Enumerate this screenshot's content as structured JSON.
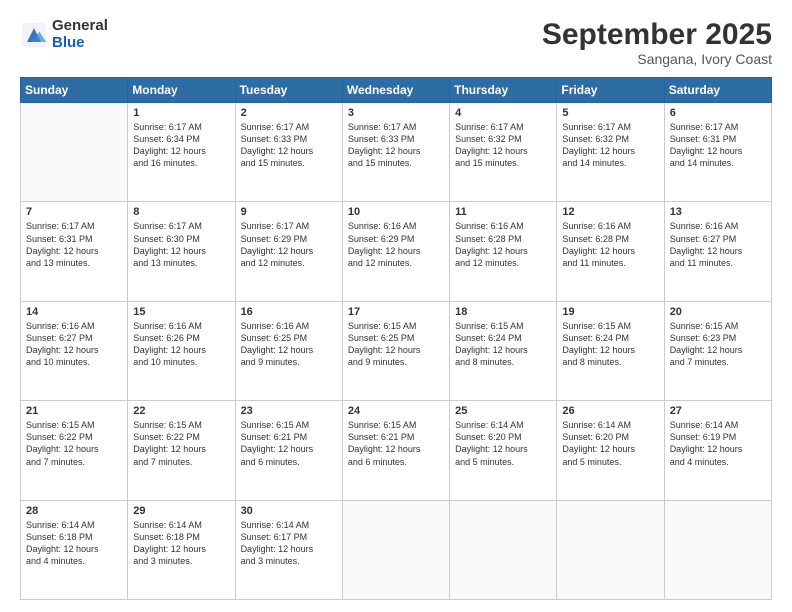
{
  "logo": {
    "general": "General",
    "blue": "Blue"
  },
  "title": {
    "month": "September 2025",
    "location": "Sangana, Ivory Coast"
  },
  "days_header": [
    "Sunday",
    "Monday",
    "Tuesday",
    "Wednesday",
    "Thursday",
    "Friday",
    "Saturday"
  ],
  "weeks": [
    [
      {
        "day": "",
        "info": ""
      },
      {
        "day": "1",
        "info": "Sunrise: 6:17 AM\nSunset: 6:34 PM\nDaylight: 12 hours\nand 16 minutes."
      },
      {
        "day": "2",
        "info": "Sunrise: 6:17 AM\nSunset: 6:33 PM\nDaylight: 12 hours\nand 15 minutes."
      },
      {
        "day": "3",
        "info": "Sunrise: 6:17 AM\nSunset: 6:33 PM\nDaylight: 12 hours\nand 15 minutes."
      },
      {
        "day": "4",
        "info": "Sunrise: 6:17 AM\nSunset: 6:32 PM\nDaylight: 12 hours\nand 15 minutes."
      },
      {
        "day": "5",
        "info": "Sunrise: 6:17 AM\nSunset: 6:32 PM\nDaylight: 12 hours\nand 14 minutes."
      },
      {
        "day": "6",
        "info": "Sunrise: 6:17 AM\nSunset: 6:31 PM\nDaylight: 12 hours\nand 14 minutes."
      }
    ],
    [
      {
        "day": "7",
        "info": "Sunrise: 6:17 AM\nSunset: 6:31 PM\nDaylight: 12 hours\nand 13 minutes."
      },
      {
        "day": "8",
        "info": "Sunrise: 6:17 AM\nSunset: 6:30 PM\nDaylight: 12 hours\nand 13 minutes."
      },
      {
        "day": "9",
        "info": "Sunrise: 6:17 AM\nSunset: 6:29 PM\nDaylight: 12 hours\nand 12 minutes."
      },
      {
        "day": "10",
        "info": "Sunrise: 6:16 AM\nSunset: 6:29 PM\nDaylight: 12 hours\nand 12 minutes."
      },
      {
        "day": "11",
        "info": "Sunrise: 6:16 AM\nSunset: 6:28 PM\nDaylight: 12 hours\nand 12 minutes."
      },
      {
        "day": "12",
        "info": "Sunrise: 6:16 AM\nSunset: 6:28 PM\nDaylight: 12 hours\nand 11 minutes."
      },
      {
        "day": "13",
        "info": "Sunrise: 6:16 AM\nSunset: 6:27 PM\nDaylight: 12 hours\nand 11 minutes."
      }
    ],
    [
      {
        "day": "14",
        "info": "Sunrise: 6:16 AM\nSunset: 6:27 PM\nDaylight: 12 hours\nand 10 minutes."
      },
      {
        "day": "15",
        "info": "Sunrise: 6:16 AM\nSunset: 6:26 PM\nDaylight: 12 hours\nand 10 minutes."
      },
      {
        "day": "16",
        "info": "Sunrise: 6:16 AM\nSunset: 6:25 PM\nDaylight: 12 hours\nand 9 minutes."
      },
      {
        "day": "17",
        "info": "Sunrise: 6:15 AM\nSunset: 6:25 PM\nDaylight: 12 hours\nand 9 minutes."
      },
      {
        "day": "18",
        "info": "Sunrise: 6:15 AM\nSunset: 6:24 PM\nDaylight: 12 hours\nand 8 minutes."
      },
      {
        "day": "19",
        "info": "Sunrise: 6:15 AM\nSunset: 6:24 PM\nDaylight: 12 hours\nand 8 minutes."
      },
      {
        "day": "20",
        "info": "Sunrise: 6:15 AM\nSunset: 6:23 PM\nDaylight: 12 hours\nand 7 minutes."
      }
    ],
    [
      {
        "day": "21",
        "info": "Sunrise: 6:15 AM\nSunset: 6:22 PM\nDaylight: 12 hours\nand 7 minutes."
      },
      {
        "day": "22",
        "info": "Sunrise: 6:15 AM\nSunset: 6:22 PM\nDaylight: 12 hours\nand 7 minutes."
      },
      {
        "day": "23",
        "info": "Sunrise: 6:15 AM\nSunset: 6:21 PM\nDaylight: 12 hours\nand 6 minutes."
      },
      {
        "day": "24",
        "info": "Sunrise: 6:15 AM\nSunset: 6:21 PM\nDaylight: 12 hours\nand 6 minutes."
      },
      {
        "day": "25",
        "info": "Sunrise: 6:14 AM\nSunset: 6:20 PM\nDaylight: 12 hours\nand 5 minutes."
      },
      {
        "day": "26",
        "info": "Sunrise: 6:14 AM\nSunset: 6:20 PM\nDaylight: 12 hours\nand 5 minutes."
      },
      {
        "day": "27",
        "info": "Sunrise: 6:14 AM\nSunset: 6:19 PM\nDaylight: 12 hours\nand 4 minutes."
      }
    ],
    [
      {
        "day": "28",
        "info": "Sunrise: 6:14 AM\nSunset: 6:18 PM\nDaylight: 12 hours\nand 4 minutes."
      },
      {
        "day": "29",
        "info": "Sunrise: 6:14 AM\nSunset: 6:18 PM\nDaylight: 12 hours\nand 3 minutes."
      },
      {
        "day": "30",
        "info": "Sunrise: 6:14 AM\nSunset: 6:17 PM\nDaylight: 12 hours\nand 3 minutes."
      },
      {
        "day": "",
        "info": ""
      },
      {
        "day": "",
        "info": ""
      },
      {
        "day": "",
        "info": ""
      },
      {
        "day": "",
        "info": ""
      }
    ]
  ]
}
